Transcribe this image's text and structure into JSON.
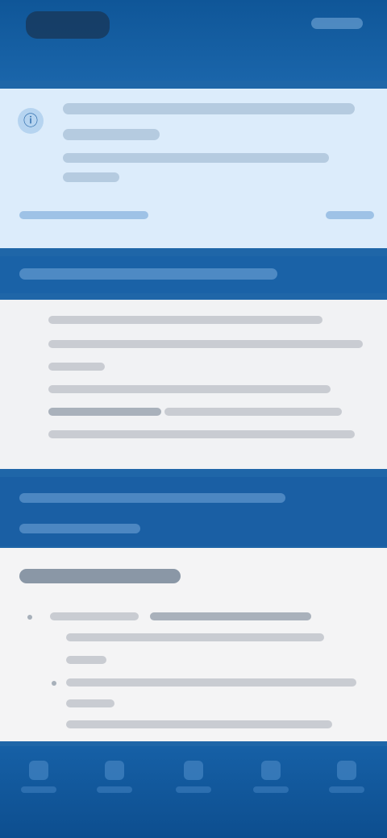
{
  "status_bar": {
    "pill_label": "",
    "indicators": ""
  },
  "notice": {
    "icon": "info-icon",
    "lines": [
      "",
      "",
      ""
    ],
    "link_left": "",
    "link_right": ""
  },
  "section_band": {
    "label": ""
  },
  "content": {
    "lines": [
      "",
      "",
      "",
      "",
      "",
      "",
      ""
    ]
  },
  "banner": {
    "lines": [
      "",
      ""
    ]
  },
  "article": {
    "title": "",
    "bullets": [
      "",
      "",
      "",
      ""
    ]
  },
  "bottom_nav": {
    "items": [
      {
        "label": "",
        "icon": "home-icon"
      },
      {
        "label": "",
        "icon": "list-icon"
      },
      {
        "label": "",
        "icon": "search-icon"
      },
      {
        "label": "",
        "icon": "bell-icon"
      },
      {
        "label": "",
        "icon": "menu-icon"
      }
    ]
  },
  "colors": {
    "primary": "#1a62a7",
    "notice_bg": "#dcecfb",
    "card_bg": "#f1f2f4"
  }
}
